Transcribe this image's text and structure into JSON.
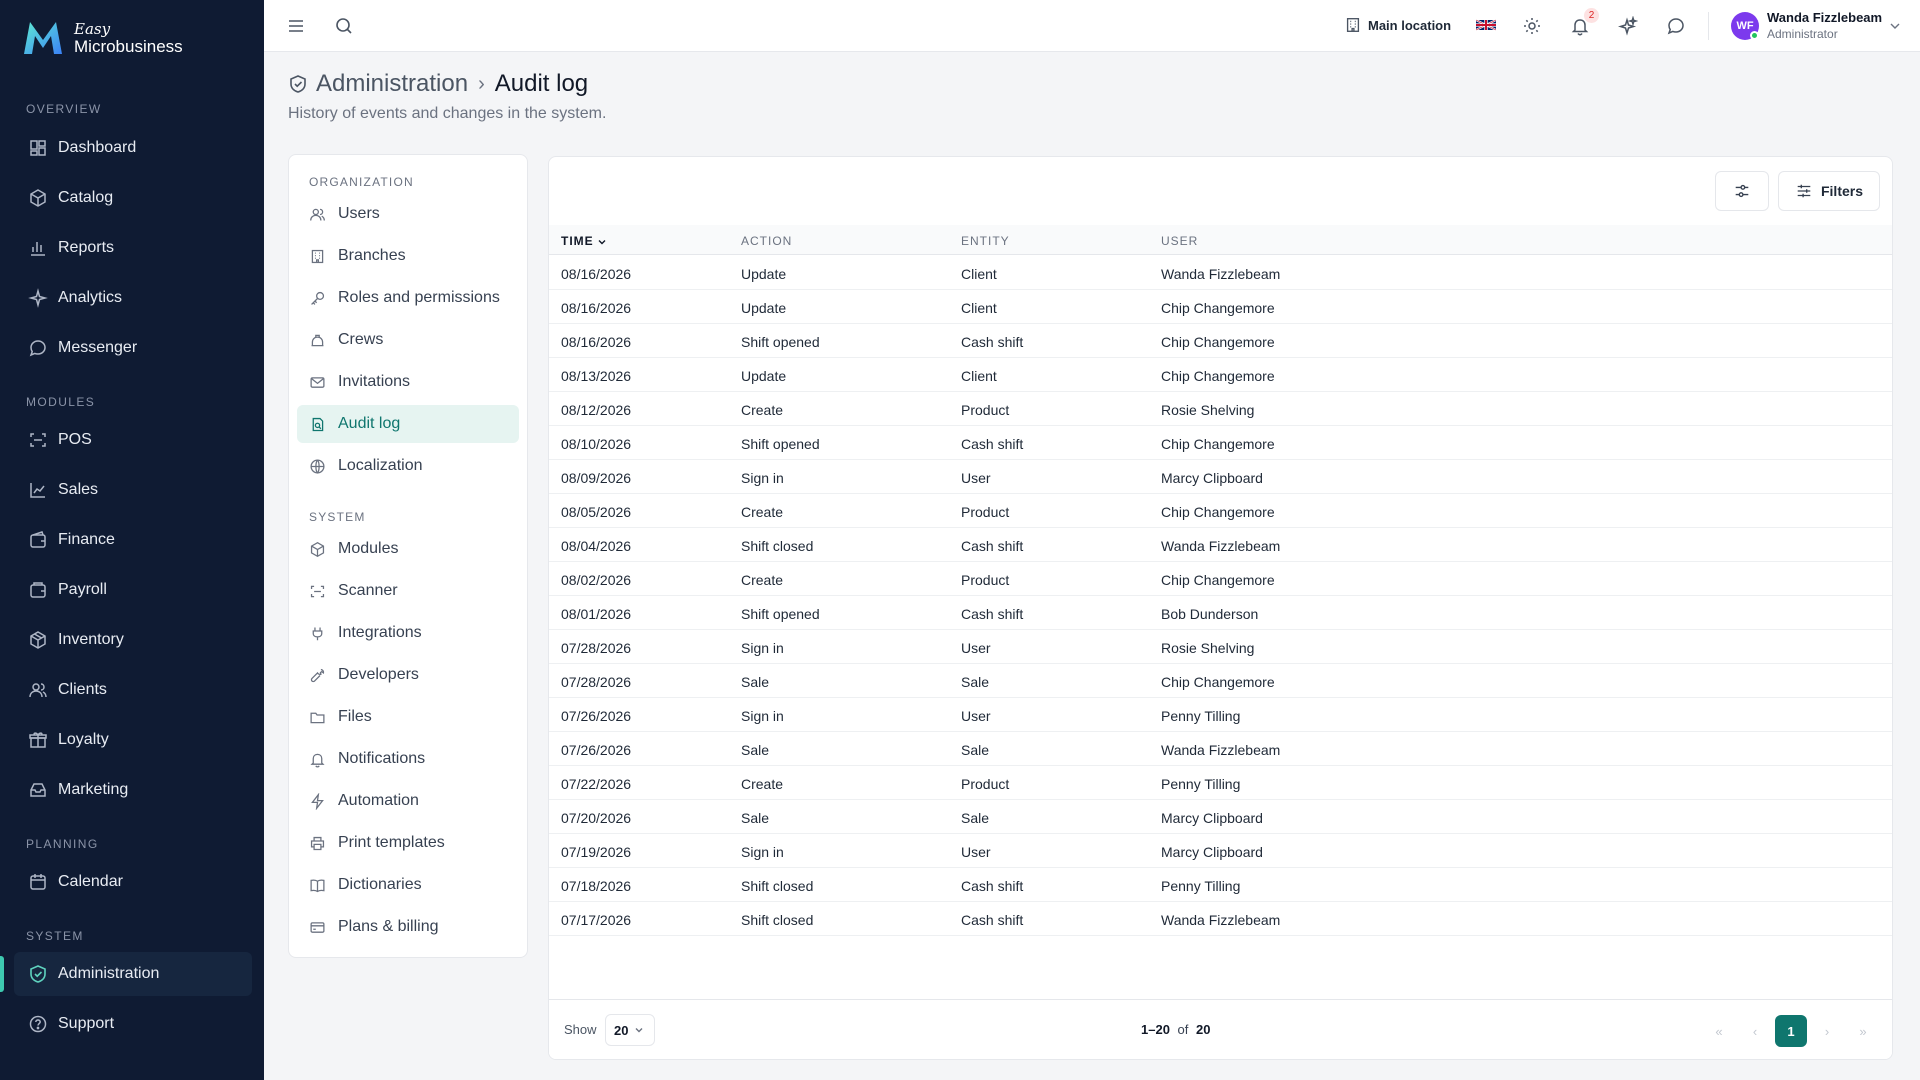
{
  "brand": {
    "easy": "Easy",
    "name": "Microbusiness"
  },
  "sidebar": {
    "sections": [
      {
        "label": "OVERVIEW",
        "items": [
          {
            "label": "Dashboard",
            "icon": "dashboard-icon"
          },
          {
            "label": "Catalog",
            "icon": "catalog-icon"
          },
          {
            "label": "Reports",
            "icon": "reports-icon"
          },
          {
            "label": "Analytics",
            "icon": "analytics-icon"
          },
          {
            "label": "Messenger",
            "icon": "messenger-icon"
          }
        ]
      },
      {
        "label": "MODULES",
        "items": [
          {
            "label": "POS",
            "icon": "pos-icon"
          },
          {
            "label": "Sales",
            "icon": "sales-icon"
          },
          {
            "label": "Finance",
            "icon": "finance-icon"
          },
          {
            "label": "Payroll",
            "icon": "payroll-icon"
          },
          {
            "label": "Inventory",
            "icon": "inventory-icon"
          },
          {
            "label": "Clients",
            "icon": "clients-icon"
          },
          {
            "label": "Loyalty",
            "icon": "loyalty-icon"
          },
          {
            "label": "Marketing",
            "icon": "marketing-icon"
          }
        ]
      },
      {
        "label": "PLANNING",
        "items": [
          {
            "label": "Calendar",
            "icon": "calendar-icon"
          }
        ]
      },
      {
        "label": "SYSTEM",
        "items": [
          {
            "label": "Administration",
            "icon": "shield-icon",
            "active": true
          },
          {
            "label": "Support",
            "icon": "help-icon"
          }
        ]
      }
    ]
  },
  "topbar": {
    "location": "Main location",
    "notifications_count": "2",
    "user": {
      "initials": "WF",
      "name": "Wanda Fizzlebeam",
      "role": "Administrator"
    }
  },
  "page": {
    "breadcrumb_parent": "Administration",
    "breadcrumb_sep": "›",
    "title": "Audit log",
    "subtitle": "History of events and changes in the system."
  },
  "settings_menu": {
    "sections": [
      {
        "label": "ORGANIZATION",
        "items": [
          {
            "label": "Users",
            "icon": "users-icon"
          },
          {
            "label": "Branches",
            "icon": "building-icon"
          },
          {
            "label": "Roles and permissions",
            "icon": "key-icon"
          },
          {
            "label": "Crews",
            "icon": "crew-icon"
          },
          {
            "label": "Invitations",
            "icon": "mail-icon"
          },
          {
            "label": "Audit log",
            "icon": "audit-icon",
            "active": true
          },
          {
            "label": "Localization",
            "icon": "globe-icon"
          }
        ]
      },
      {
        "label": "SYSTEM",
        "items": [
          {
            "label": "Modules",
            "icon": "box-icon"
          },
          {
            "label": "Scanner",
            "icon": "scan-icon"
          },
          {
            "label": "Integrations",
            "icon": "plug-icon"
          },
          {
            "label": "Developers",
            "icon": "wrench-icon"
          },
          {
            "label": "Files",
            "icon": "folder-icon"
          },
          {
            "label": "Notifications",
            "icon": "bell-icon"
          },
          {
            "label": "Automation",
            "icon": "bolt-icon"
          },
          {
            "label": "Print templates",
            "icon": "printer-icon"
          },
          {
            "label": "Dictionaries",
            "icon": "book-icon"
          },
          {
            "label": "Plans & billing",
            "icon": "card-icon"
          }
        ]
      }
    ]
  },
  "table": {
    "filters_label": "Filters",
    "columns": [
      "TIME",
      "ACTION",
      "ENTITY",
      "USER"
    ],
    "rows": [
      [
        "08/16/2026",
        "Update",
        "Client",
        "Wanda Fizzlebeam"
      ],
      [
        "08/16/2026",
        "Update",
        "Client",
        "Chip Changemore"
      ],
      [
        "08/16/2026",
        "Shift opened",
        "Cash shift",
        "Chip Changemore"
      ],
      [
        "08/13/2026",
        "Update",
        "Client",
        "Chip Changemore"
      ],
      [
        "08/12/2026",
        "Create",
        "Product",
        "Rosie Shelving"
      ],
      [
        "08/10/2026",
        "Shift opened",
        "Cash shift",
        "Chip Changemore"
      ],
      [
        "08/09/2026",
        "Sign in",
        "User",
        "Marcy Clipboard"
      ],
      [
        "08/05/2026",
        "Create",
        "Product",
        "Chip Changemore"
      ],
      [
        "08/04/2026",
        "Shift closed",
        "Cash shift",
        "Wanda Fizzlebeam"
      ],
      [
        "08/02/2026",
        "Create",
        "Product",
        "Chip Changemore"
      ],
      [
        "08/01/2026",
        "Shift opened",
        "Cash shift",
        "Bob Dunderson"
      ],
      [
        "07/28/2026",
        "Sign in",
        "User",
        "Rosie Shelving"
      ],
      [
        "07/28/2026",
        "Sale",
        "Sale",
        "Chip Changemore"
      ],
      [
        "07/26/2026",
        "Sign in",
        "User",
        "Penny Tilling"
      ],
      [
        "07/26/2026",
        "Sale",
        "Sale",
        "Wanda Fizzlebeam"
      ],
      [
        "07/22/2026",
        "Create",
        "Product",
        "Penny Tilling"
      ],
      [
        "07/20/2026",
        "Sale",
        "Sale",
        "Marcy Clipboard"
      ],
      [
        "07/19/2026",
        "Sign in",
        "User",
        "Marcy Clipboard"
      ],
      [
        "07/18/2026",
        "Shift closed",
        "Cash shift",
        "Penny Tilling"
      ],
      [
        "07/17/2026",
        "Shift closed",
        "Cash shift",
        "Wanda Fizzlebeam"
      ]
    ],
    "footer": {
      "show_label": "Show",
      "page_size": "20",
      "range": "1–20",
      "of_label": "of",
      "total": "20",
      "current_page": "1",
      "first": "«",
      "prev": "‹",
      "next": "›",
      "last": "»"
    }
  },
  "colors": {
    "sidebar_bg": "#0f1b33",
    "accent": "#0f766e",
    "active_menu_bg": "#e6f4f1"
  }
}
